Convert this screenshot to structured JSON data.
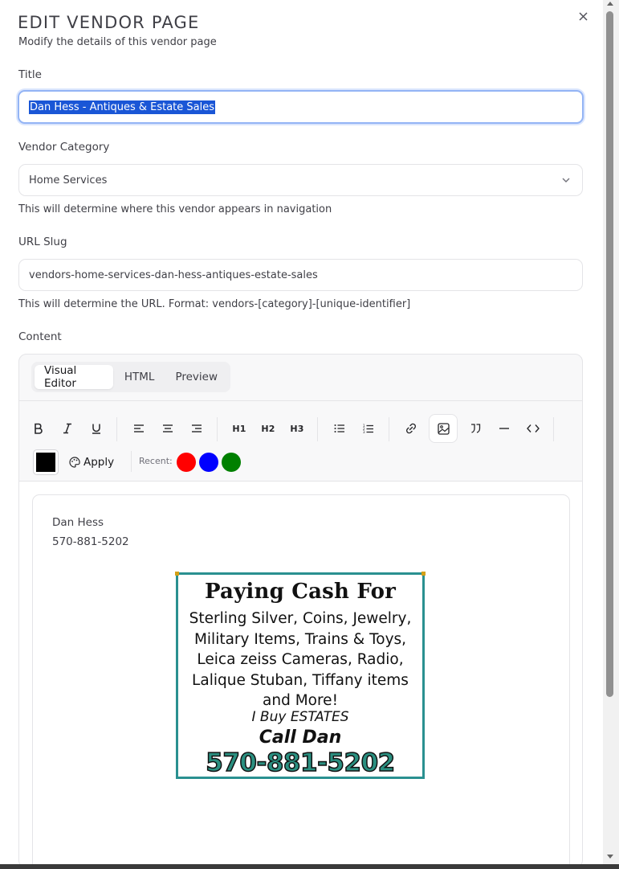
{
  "header": {
    "title": "EDIT VENDOR PAGE",
    "subtitle": "Modify the details of this vendor page",
    "close_icon": "close-icon"
  },
  "form": {
    "title_label": "Title",
    "title_value": "Dan Hess - Antiques & Estate Sales",
    "category_label": "Vendor Category",
    "category_value": "Home Services",
    "category_helper": "This will determine where this vendor appears in navigation",
    "slug_label": "URL Slug",
    "slug_value": "vendors-home-services-dan-hess-antiques-estate-sales",
    "slug_helper": "This will determine the URL. Format: vendors-[category]-[unique-identifier]",
    "content_label": "Content"
  },
  "editor": {
    "tabs": [
      {
        "label": "Visual Editor",
        "active": true
      },
      {
        "label": "HTML",
        "active": false
      },
      {
        "label": "Preview",
        "active": false
      }
    ],
    "toolbar": {
      "heading_labels": [
        "H1",
        "H2",
        "H3"
      ],
      "apply_label": "Apply",
      "recent_label": "Recent:",
      "current_color": "#000000",
      "recent_colors": [
        "#ff0000",
        "#0000ff",
        "#008000"
      ],
      "active_tool": "image"
    },
    "content": {
      "line1": "Dan Hess",
      "line2": "570-881-5202",
      "ad": {
        "title": "Paying Cash For",
        "lines": [
          "Sterling Silver, Coins, Jewelry,",
          "Military Items, Trains & Toys,",
          "Leica zeiss Cameras, Radio,",
          "Lalique Stuban, Tiffany items",
          "and More!"
        ],
        "estates": "I Buy ESTATES",
        "call": "Call Dan",
        "phone": "570-881-5202"
      }
    }
  },
  "colors": {
    "focus_ring": "#93b4f5",
    "selection": "#1a56d6",
    "ad_border": "#2a9090",
    "ad_phone": "#2a8f80"
  }
}
